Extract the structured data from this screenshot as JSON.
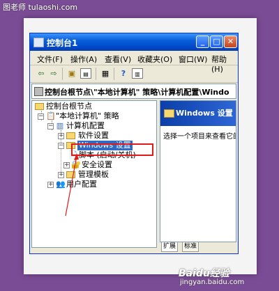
{
  "watermark_top": "图老师 tulaoshi.com",
  "window": {
    "title": "控制台1",
    "controls": {
      "minimize": "_",
      "maximize": "□",
      "close": "✕"
    }
  },
  "menu": [
    "文件(F)",
    "操作(A)",
    "查看(V)",
    "收藏夹(O)",
    "窗口(W)",
    "帮助(H)"
  ],
  "path_bar": "控制台根节点\\\"本地计算机\" 策略\\计算机配置\\Windo",
  "tree": {
    "root": "控制台根节点",
    "policy": "\"本地计算机\" 策略",
    "computer_config": "计算机配置",
    "software_settings": "软件设置",
    "windows_settings": "Windows 设置",
    "scripts": "脚本 (启动/关机)",
    "security_settings": "安全设置",
    "admin_templates": "管理模板",
    "user_config": "用户配置"
  },
  "right_pane": {
    "header": "Windows 设置",
    "description": "选择一个项目来查看它的"
  },
  "tabs": [
    "扩展",
    "标准"
  ],
  "watermark_logo": "Baidu经验",
  "watermark_url": "jingyan.baidu.com",
  "colors": {
    "background": "#7b4c96",
    "title_bar": "#0a5fd8",
    "highlight_box": "#e01919"
  }
}
